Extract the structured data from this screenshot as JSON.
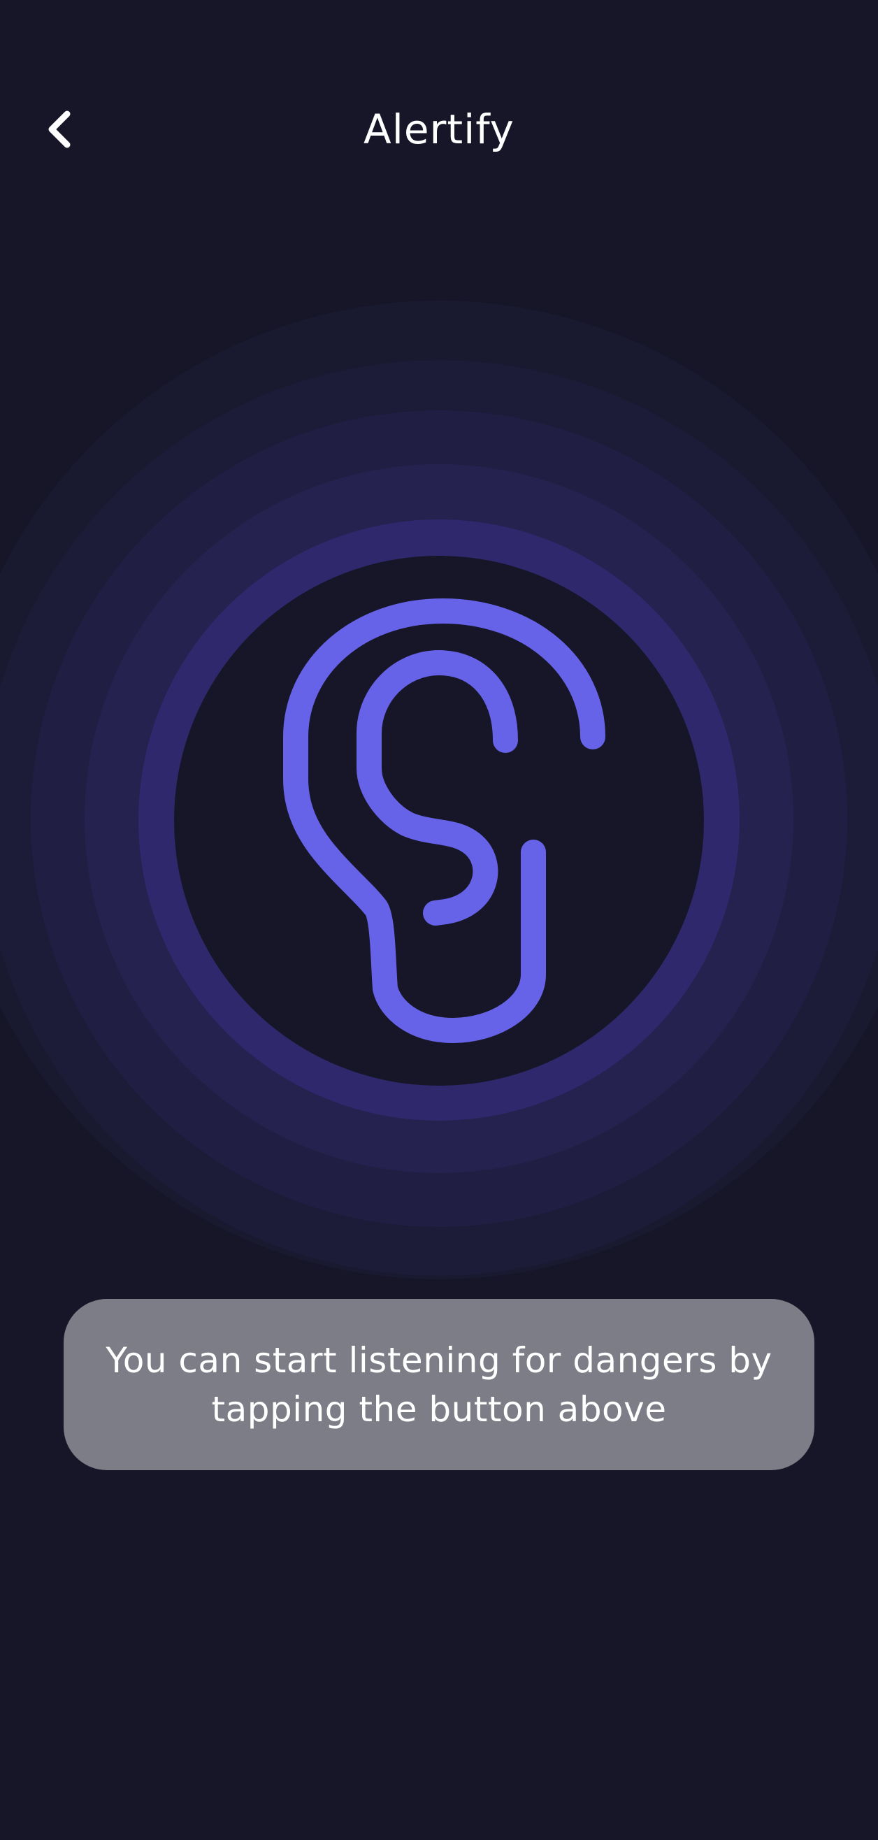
{
  "app_bar": {
    "title": "Alertify",
    "back_icon": "chevron-left-icon"
  },
  "listen_button": {
    "icon": "ear-icon",
    "accent_color": "#6763e8"
  },
  "toast": {
    "message": "You can start listening for dangers by tapping the button above"
  },
  "colors": {
    "background": "#161628",
    "accent": "#6763e8",
    "toast_background": "#7c7d86"
  }
}
